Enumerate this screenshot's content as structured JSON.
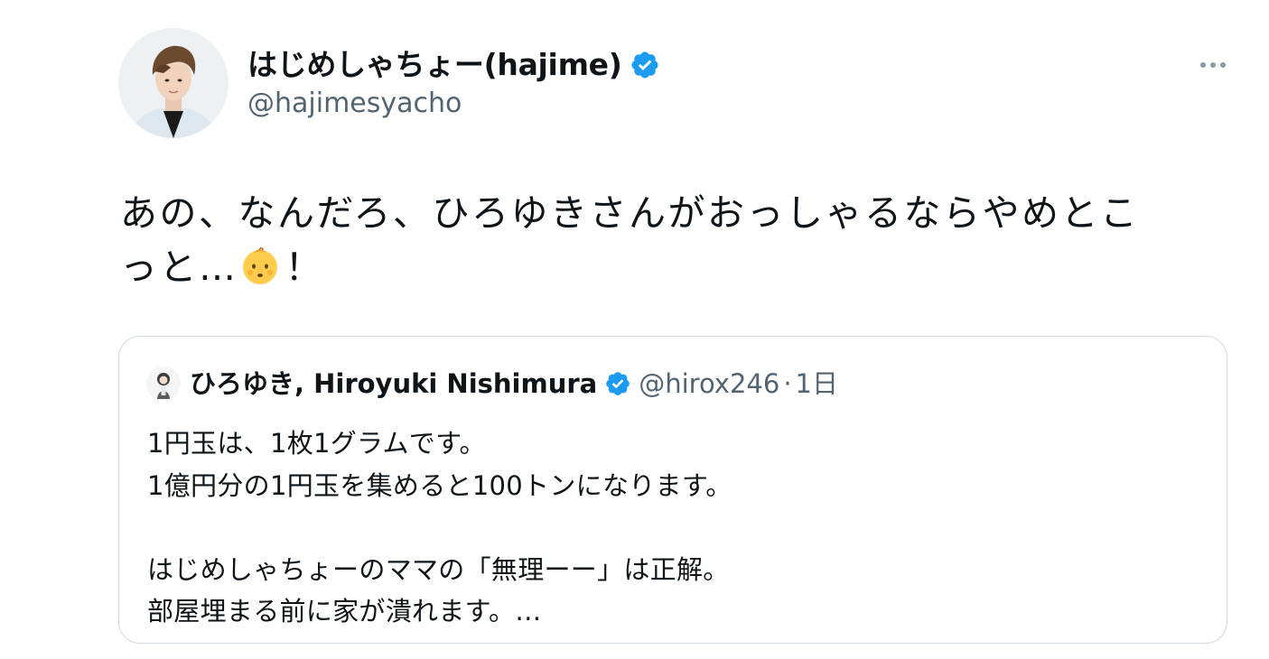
{
  "author": {
    "name": "はじめしゃちょー(hajime)",
    "handle": "@hajimesyacho",
    "verified": true,
    "avatar_icon": "user-avatar-photo"
  },
  "tweet": {
    "text_part1": "あの、なんだろ、ひろゆきさんがおっしゃるならやめとこ\nっと…",
    "emoji": "baby-face-emoji",
    "text_part2": "！"
  },
  "quote": {
    "name": "ひろゆき, Hiroyuki Nishimura",
    "handle": "@hirox246",
    "separator": "·",
    "time": "1日",
    "verified": true,
    "lines": [
      "1円玉は、1枚1グラムです。",
      "1億円分の1円玉を集めると100トンになります。",
      "",
      "はじめしゃちょーのママの「無理ーー」は正解。",
      "部屋埋まる前に家が潰れます。…"
    ]
  },
  "colors": {
    "verified_blue": "#1d9bf0",
    "secondary_text": "#536471",
    "border": "#cfd9de",
    "primary_text": "#0f1419"
  },
  "icons": {
    "more": "more-horizontal-icon",
    "verified": "verified-badge-icon"
  }
}
